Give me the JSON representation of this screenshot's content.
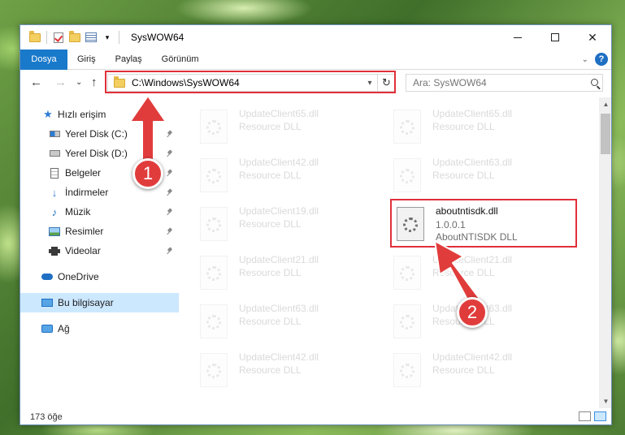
{
  "window": {
    "title": "SysWOW64",
    "controls": {
      "minimize": "–",
      "maximize": "□",
      "close": "✕"
    }
  },
  "ribbon": {
    "tabs": [
      {
        "label": "Dosya",
        "active": true
      },
      {
        "label": "Giriş"
      },
      {
        "label": "Paylaş"
      },
      {
        "label": "Görünüm"
      }
    ],
    "help": "?"
  },
  "nav_buttons": {
    "back": "←",
    "forward": "→",
    "recent": "⌄",
    "up": "↑"
  },
  "address": {
    "path": "C:\\Windows\\SysWOW64",
    "refresh": "↻"
  },
  "search": {
    "placeholder": "Ara: SysWOW64"
  },
  "sidebar": {
    "items": [
      {
        "label": "Hızlı erişim",
        "icon": "star-icon"
      },
      {
        "label": "Yerel Disk (C:)",
        "icon": "windows-disk-icon",
        "pinned": true
      },
      {
        "label": "Yerel Disk (D:)",
        "icon": "disk-icon",
        "pinned": true
      },
      {
        "label": "Belgeler",
        "icon": "documents-icon",
        "pinned": true
      },
      {
        "label": "İndirmeler",
        "icon": "download-icon",
        "pinned": true
      },
      {
        "label": "Müzik",
        "icon": "music-icon",
        "pinned": true
      },
      {
        "label": "Resimler",
        "icon": "pictures-icon",
        "pinned": true
      },
      {
        "label": "Videolar",
        "icon": "videos-icon",
        "pinned": true
      },
      {
        "label": "OneDrive",
        "icon": "onedrive-icon"
      },
      {
        "label": "Bu bilgisayar",
        "icon": "this-pc-icon",
        "selected": true
      },
      {
        "label": "Ağ",
        "icon": "network-icon"
      }
    ]
  },
  "files": {
    "left_column": [
      {
        "name": "UpdateClient65.dll",
        "type": "Resource DLL"
      },
      {
        "name": "UpdateClient42.dll",
        "type": "Resource DLL"
      },
      {
        "name": "UpdateClient19.dll",
        "type": "Resource DLL"
      },
      {
        "name": "UpdateClient21.dll",
        "type": "Resource DLL"
      },
      {
        "name": "UpdateClient63.dll",
        "type": "Resource DLL"
      },
      {
        "name": "UpdateClient42.dll",
        "type": "Resource DLL"
      }
    ],
    "right_column": [
      {
        "name": "UpdateClient65.dll",
        "type": "Resource DLL"
      },
      {
        "name": "UpdateClient63.dll",
        "type": "Resource DLL"
      },
      {
        "name": "UpdateClient21.dll",
        "type": "Resource DLL"
      },
      {
        "name": "UpdateClient63.dll",
        "type": "Resource DLL"
      },
      {
        "name": "UpdateClient42.dll",
        "type": "Resource DLL"
      }
    ],
    "highlighted": {
      "name": "aboutntisdk.dll",
      "version": "1.0.0.1",
      "description": "AboutNTISDK DLL"
    }
  },
  "status": {
    "item_count": "173 öğe"
  },
  "annotations": {
    "step1": "1",
    "step2": "2",
    "color": "#e0303a"
  }
}
